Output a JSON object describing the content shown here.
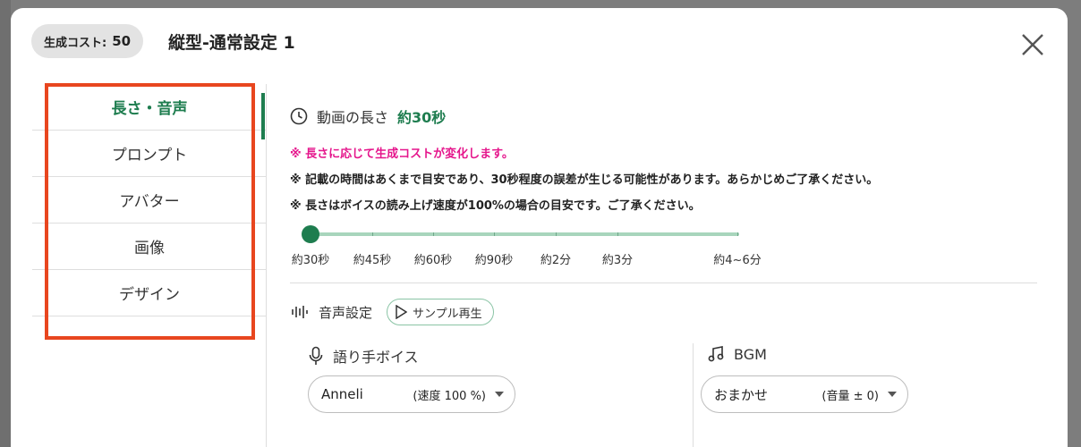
{
  "header": {
    "cost_label": "生成コスト:",
    "cost_value": "50",
    "title": "縦型-通常設定 1"
  },
  "sidebar": {
    "items": [
      {
        "label": "長さ・音声",
        "active": true
      },
      {
        "label": "プロンプト",
        "active": false
      },
      {
        "label": "アバター",
        "active": false
      },
      {
        "label": "画像",
        "active": false
      },
      {
        "label": "デザイン",
        "active": false
      }
    ]
  },
  "length": {
    "title": "動画の長さ",
    "value": "約30秒",
    "note_pink": "※ 長さに応じて生成コストが変化します。",
    "note_1": "※ 記載の時間はあくまで目安であり、30秒程度の誤差が生じる可能性があります。あらかじめご了承ください。",
    "note_2": "※ 長さはボイスの読み上げ速度が100%の場合の目安です。ご了承ください。",
    "slider_labels": [
      "約30秒",
      "約45秒",
      "約60秒",
      "約90秒",
      "約2分",
      "約3分",
      "約4~6分"
    ],
    "slider_selected_index": 0
  },
  "voice": {
    "title": "音声設定",
    "sample_button": "サンプル再生",
    "narrator_title": "語り手ボイス",
    "narrator_name": "Anneli",
    "narrator_speed": "(速度 100 %)",
    "bgm_title": "BGM",
    "bgm_name": "おまかせ",
    "bgm_volume": "(音量 ± 0)"
  },
  "colors": {
    "accent": "#1e7d4f",
    "pink": "#e5168c",
    "highlight": "#e8461f"
  }
}
